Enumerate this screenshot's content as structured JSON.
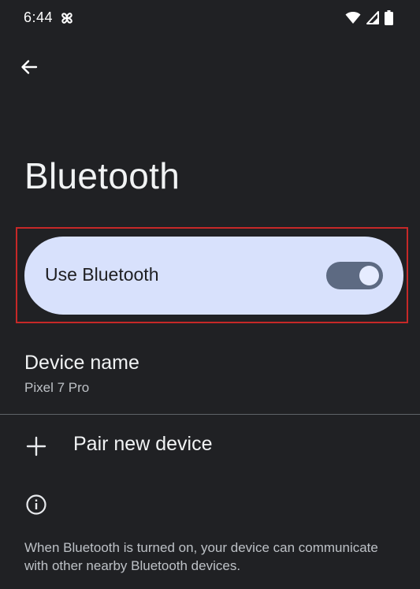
{
  "status_bar": {
    "time": "6:44",
    "notification_icon": "pinwheel-icon",
    "icons": [
      "wifi-icon",
      "signal-icon",
      "battery-icon"
    ]
  },
  "nav": {
    "back_icon": "back-arrow-icon"
  },
  "page": {
    "title": "Bluetooth"
  },
  "main_switch": {
    "label": "Use Bluetooth",
    "checked": true,
    "background": "#d8e1fc",
    "track_color": "#5d6a82",
    "thumb_color": "#e6ecff"
  },
  "highlight": {
    "color": "#c62828"
  },
  "device_name": {
    "title": "Device name",
    "value": "Pixel 7 Pro"
  },
  "pair": {
    "icon": "plus-icon",
    "label": "Pair new device"
  },
  "info": {
    "icon": "info-icon",
    "text": "When Bluetooth is turned on, your device can communicate with other nearby Bluetooth devices."
  },
  "colors": {
    "background": "#202124",
    "text_primary": "#f1f3f4",
    "text_secondary": "#bdc1c6"
  }
}
